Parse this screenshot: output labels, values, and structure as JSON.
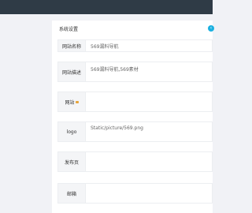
{
  "panel": {
    "title": "系统设置",
    "toggle_icon": "toggle-icon"
  },
  "rows": [
    {
      "label": "网站名称",
      "value": "569漏料导航"
    },
    {
      "label": "网站描述",
      "value": "569漏料导航,569素材"
    },
    {
      "label": "网站",
      "value": ""
    },
    {
      "label": "logo",
      "value": "Static/picture/569.png"
    },
    {
      "label": "发布页",
      "value": ""
    },
    {
      "label": "邮箱",
      "value": ""
    }
  ]
}
